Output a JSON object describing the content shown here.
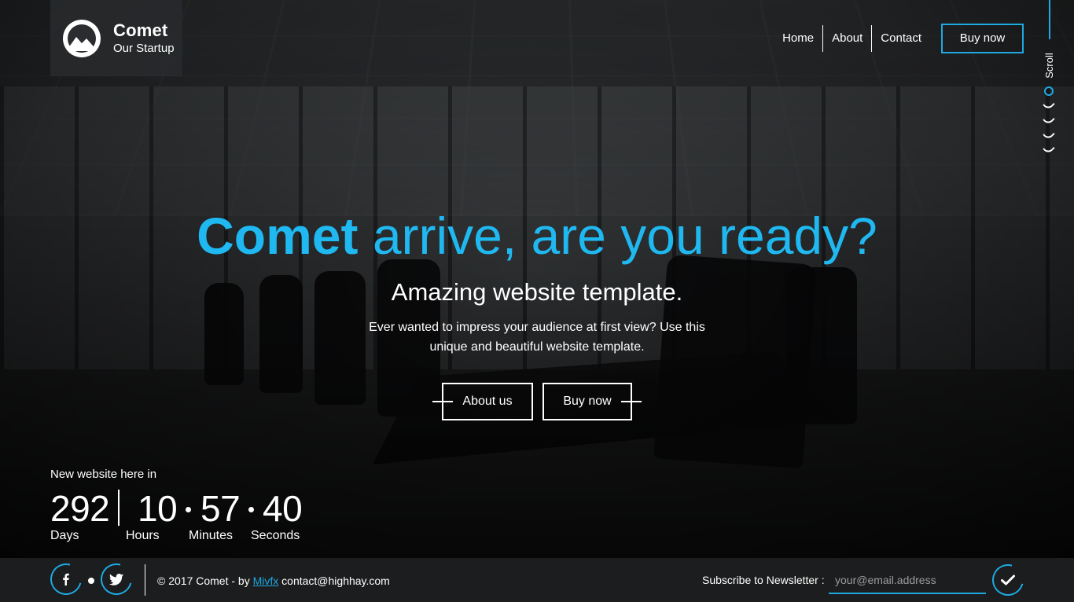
{
  "brand": {
    "name": "Comet",
    "tagline": "Our Startup",
    "logo_icon": "mountain-icon"
  },
  "nav": {
    "items": [
      "Home",
      "About",
      "Contact"
    ],
    "cta": "Buy now"
  },
  "scroll": {
    "label": "Scroll"
  },
  "hero": {
    "title_strong": "Comet",
    "title_rest": "arrive, are you ready?",
    "subtitle": "Amazing website template.",
    "description": "Ever wanted to impress your audience at first view? Use this unique and beautiful website template.",
    "buttons": {
      "about": "About us",
      "buy": "Buy now"
    }
  },
  "countdown": {
    "caption": "New website here in",
    "days": "292",
    "hours": "10",
    "minutes": "57",
    "seconds": "40",
    "labels": {
      "days": "Days",
      "hours": "Hours",
      "minutes": "Minutes",
      "seconds": "Seconds"
    }
  },
  "footer": {
    "social": [
      "facebook-icon",
      "twitter-icon"
    ],
    "copyright_prefix": "© 2017 Comet - by",
    "author_link": "Mivfx",
    "contact_email": "contact@highhay.com",
    "subscribe_label": "Subscribe to Newsletter :",
    "email_placeholder": "your@email.address",
    "submit_icon": "checkmark-icon"
  },
  "colors": {
    "accent": "#1fa9e2",
    "title_accent": "#1fb8f0"
  }
}
